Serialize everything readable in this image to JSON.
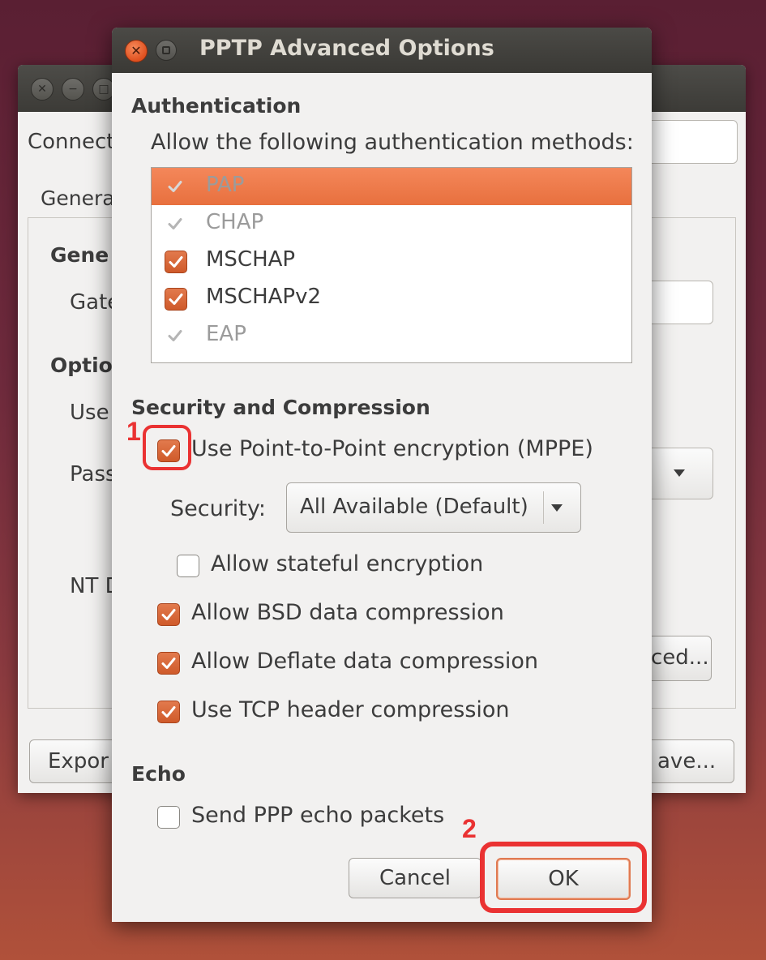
{
  "background_window": {
    "connection_label": "Connect",
    "tab_general": "Genera",
    "section_general": "Gene",
    "gateway_label": "Gate",
    "section_optional": "Optio",
    "user_label": "Use",
    "password_label": "Pass",
    "nt_domain_label": "NT D",
    "advanced_button": "ced...",
    "export_button": "Expor",
    "save_button": "ave..."
  },
  "dialog": {
    "title": "PPTP Advanced Options",
    "authentication": {
      "heading": "Authentication",
      "instruction": "Allow the following authentication methods:",
      "methods": [
        {
          "label": "PAP",
          "checked": true,
          "selected": true,
          "enabled": false
        },
        {
          "label": "CHAP",
          "checked": true,
          "selected": false,
          "enabled": false
        },
        {
          "label": "MSCHAP",
          "checked": true,
          "selected": false,
          "enabled": true
        },
        {
          "label": "MSCHAPv2",
          "checked": true,
          "selected": false,
          "enabled": true
        },
        {
          "label": "EAP",
          "checked": true,
          "selected": false,
          "enabled": false
        }
      ]
    },
    "security": {
      "heading": "Security and Compression",
      "mppe_label": "Use Point-to-Point encryption (MPPE)",
      "security_label": "Security:",
      "security_value": "All Available (Default)",
      "stateful_label": "Allow stateful encryption",
      "bsd_label": "Allow BSD data compression",
      "deflate_label": "Allow Deflate data compression",
      "tcp_label": "Use TCP header compression"
    },
    "echo": {
      "heading": "Echo",
      "ppp_echo_label": "Send PPP echo packets"
    },
    "buttons": {
      "cancel": "Cancel",
      "ok": "OK"
    }
  },
  "annotations": {
    "step1": "1",
    "step2": "2",
    "color": "#ea3232"
  },
  "colors": {
    "accent": "#e8703e",
    "titlebar": "#3c3b37"
  }
}
